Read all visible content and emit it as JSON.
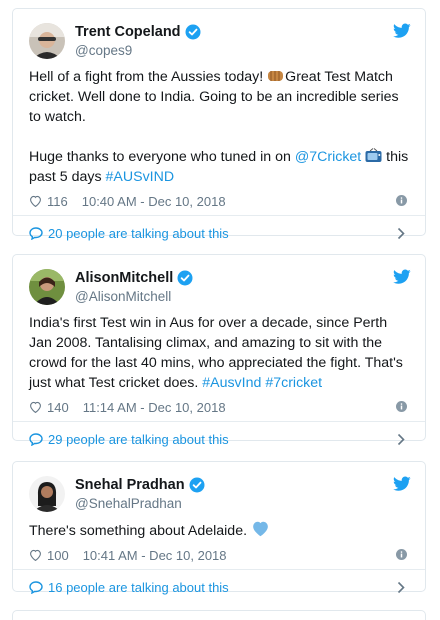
{
  "colors": {
    "link": "#1b95e0",
    "muted": "#657786",
    "border": "#e1e8ed",
    "heart_emoji": "#75b8e8"
  },
  "tweets": [
    {
      "name": "Trent Copeland",
      "handle": "@copes9",
      "text_1a": "Hell of a fight from the Aussies today! ",
      "emoji_1": "fist-bump-icon",
      "text_1b": "Great Test Match cricket. Well done to India. Going to be an incredible series to watch.",
      "text_2a": "Huge thanks to everyone who tuned in on ",
      "link_1": "@7Cricket",
      "emoji_2": "television-icon",
      "text_2b": " this past 5 days ",
      "link_2": "#AUSvIND",
      "likes": "116",
      "timestamp": "10:40 AM - Dec 10, 2018",
      "talking": "20 people are talking about this"
    },
    {
      "name": "AlisonMitchell",
      "handle": "@AlisonMitchell",
      "text_a": "India's first Test win in Aus for over a decade, since Perth Jan 2008. Tantalising climax, and amazing to sit with the crowd for the last 40 mins, who appreciated the fight. That's just what Test cricket does. ",
      "link_1": "#AusvInd",
      "link_2": "#7cricket",
      "likes": "140",
      "timestamp": "11:14 AM - Dec 10, 2018",
      "talking": "29 people are talking about this"
    },
    {
      "name": "Snehal Pradhan",
      "handle": "@SnehalPradhan",
      "text_a": "There's something about Adelaide. ",
      "emoji": "blue-heart-icon",
      "likes": "100",
      "timestamp": "10:41 AM - Dec 10, 2018",
      "talking": "16 people are talking about this"
    }
  ]
}
